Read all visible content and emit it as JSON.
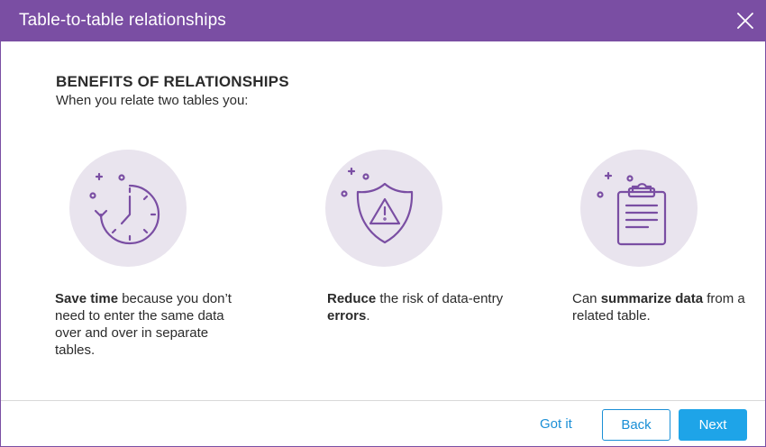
{
  "dialog": {
    "title": "Table-to-table relationships",
    "close_icon": "close-icon"
  },
  "content": {
    "heading": "BENEFITS OF RELATIONSHIPS",
    "subheading": "When you relate two tables you:"
  },
  "benefits": [
    {
      "icon": "clock-icon",
      "bold": "Save time",
      "rest": " because you don’t need to enter the same data over and over in separate tables."
    },
    {
      "icon": "shield-warning-icon",
      "bold": "Reduce",
      "middle": " the risk of data-entry ",
      "bold2": "errors",
      "end": "."
    },
    {
      "icon": "clipboard-icon",
      "prefix": "Can ",
      "bold": "summarize data",
      "rest": " from a related table."
    }
  ],
  "footer": {
    "gotit_label": "Got it",
    "back_label": "Back",
    "next_label": "Next"
  },
  "colors": {
    "titlebar": "#7a4ea3",
    "icon_circle": "#e9e4ee",
    "icon_stroke": "#7a4ea3",
    "link": "#1a8fd6",
    "primary_button": "#1ea4e8"
  }
}
